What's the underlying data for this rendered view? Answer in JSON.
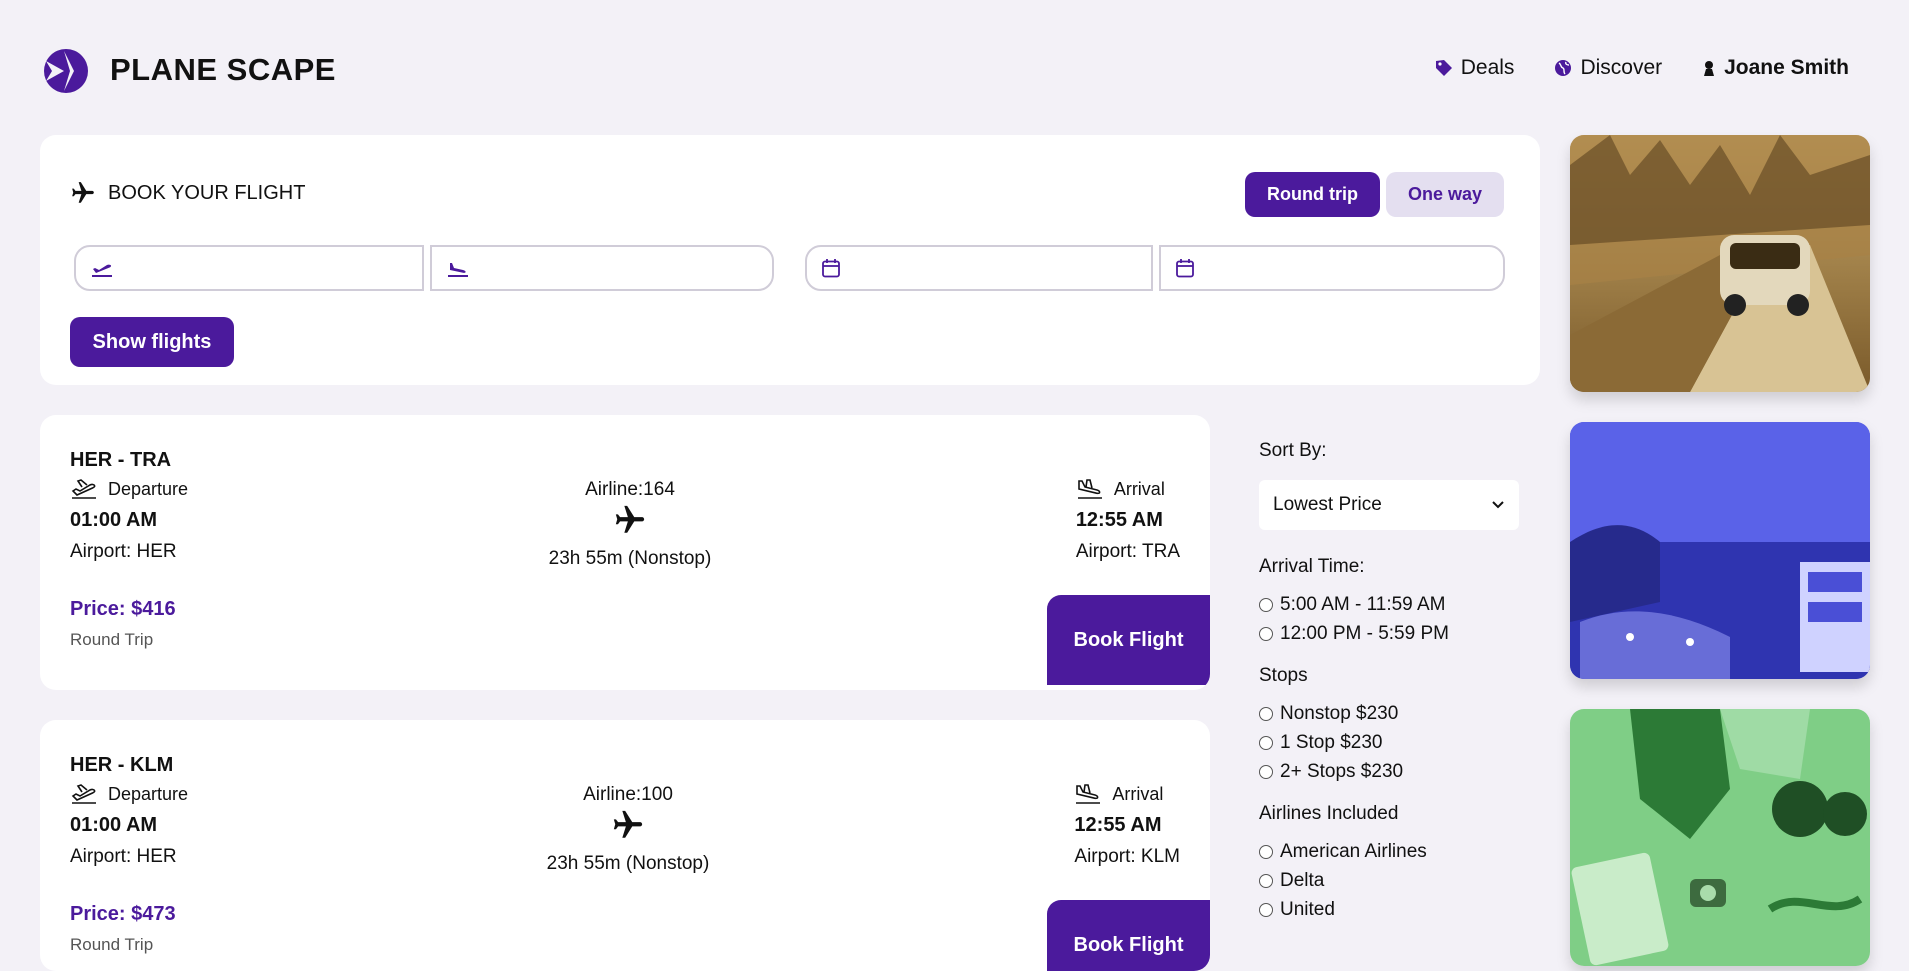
{
  "header": {
    "brand": "PLANE SCAPE",
    "nav": [
      {
        "label": "Deals",
        "icon": "tag-icon"
      },
      {
        "label": "Discover",
        "icon": "globe-icon"
      },
      {
        "label": "Joane Smith",
        "icon": "user-icon"
      }
    ]
  },
  "booking": {
    "title": "BOOK YOUR FLIGHT",
    "trip_options": [
      "Round trip",
      "One way"
    ],
    "selected_trip": "Round trip",
    "from_value": "",
    "to_value": "",
    "depart_date": "",
    "return_date": "",
    "show_flights_label": "Show flights"
  },
  "flights": [
    {
      "route": "HER - TRA",
      "departure_label": "Departure",
      "departure_time": "01:00 AM",
      "departure_airport": "Airport: HER",
      "airline": "Airline:164",
      "duration": "23h 55m (Nonstop)",
      "arrival_label": "Arrival",
      "arrival_time": "12:55 AM",
      "arrival_airport": "Airport: TRA",
      "price": "Price: $416",
      "trip_type": "Round Trip",
      "book_label": "Book Flight"
    },
    {
      "route": "HER - KLM",
      "departure_label": "Departure",
      "departure_time": "01:00 AM",
      "departure_airport": "Airport: HER",
      "airline": "Airline:100",
      "duration": "23h 55m (Nonstop)",
      "arrival_label": "Arrival",
      "arrival_time": "12:55 AM",
      "arrival_airport": "Airport: KLM",
      "price": "Price: $473",
      "trip_type": "Round Trip",
      "book_label": "Book Flight"
    }
  ],
  "filters": {
    "sort_label": "Sort By:",
    "sort_value": "Lowest Price",
    "arrival_label": "Arrival Time:",
    "arrival_options": [
      "5:00 AM - 11:59 AM",
      "12:00 PM - 5:59 PM"
    ],
    "stops_label": "Stops",
    "stops_options": [
      "Nonstop $230",
      "1 Stop $230",
      "2+ Stops $230"
    ],
    "airlines_label": "Airlines Included",
    "airlines_options": [
      "American Airlines",
      "Delta",
      "United"
    ]
  },
  "colors": {
    "accent": "#4b1a9c",
    "background": "#f3f1f7"
  }
}
